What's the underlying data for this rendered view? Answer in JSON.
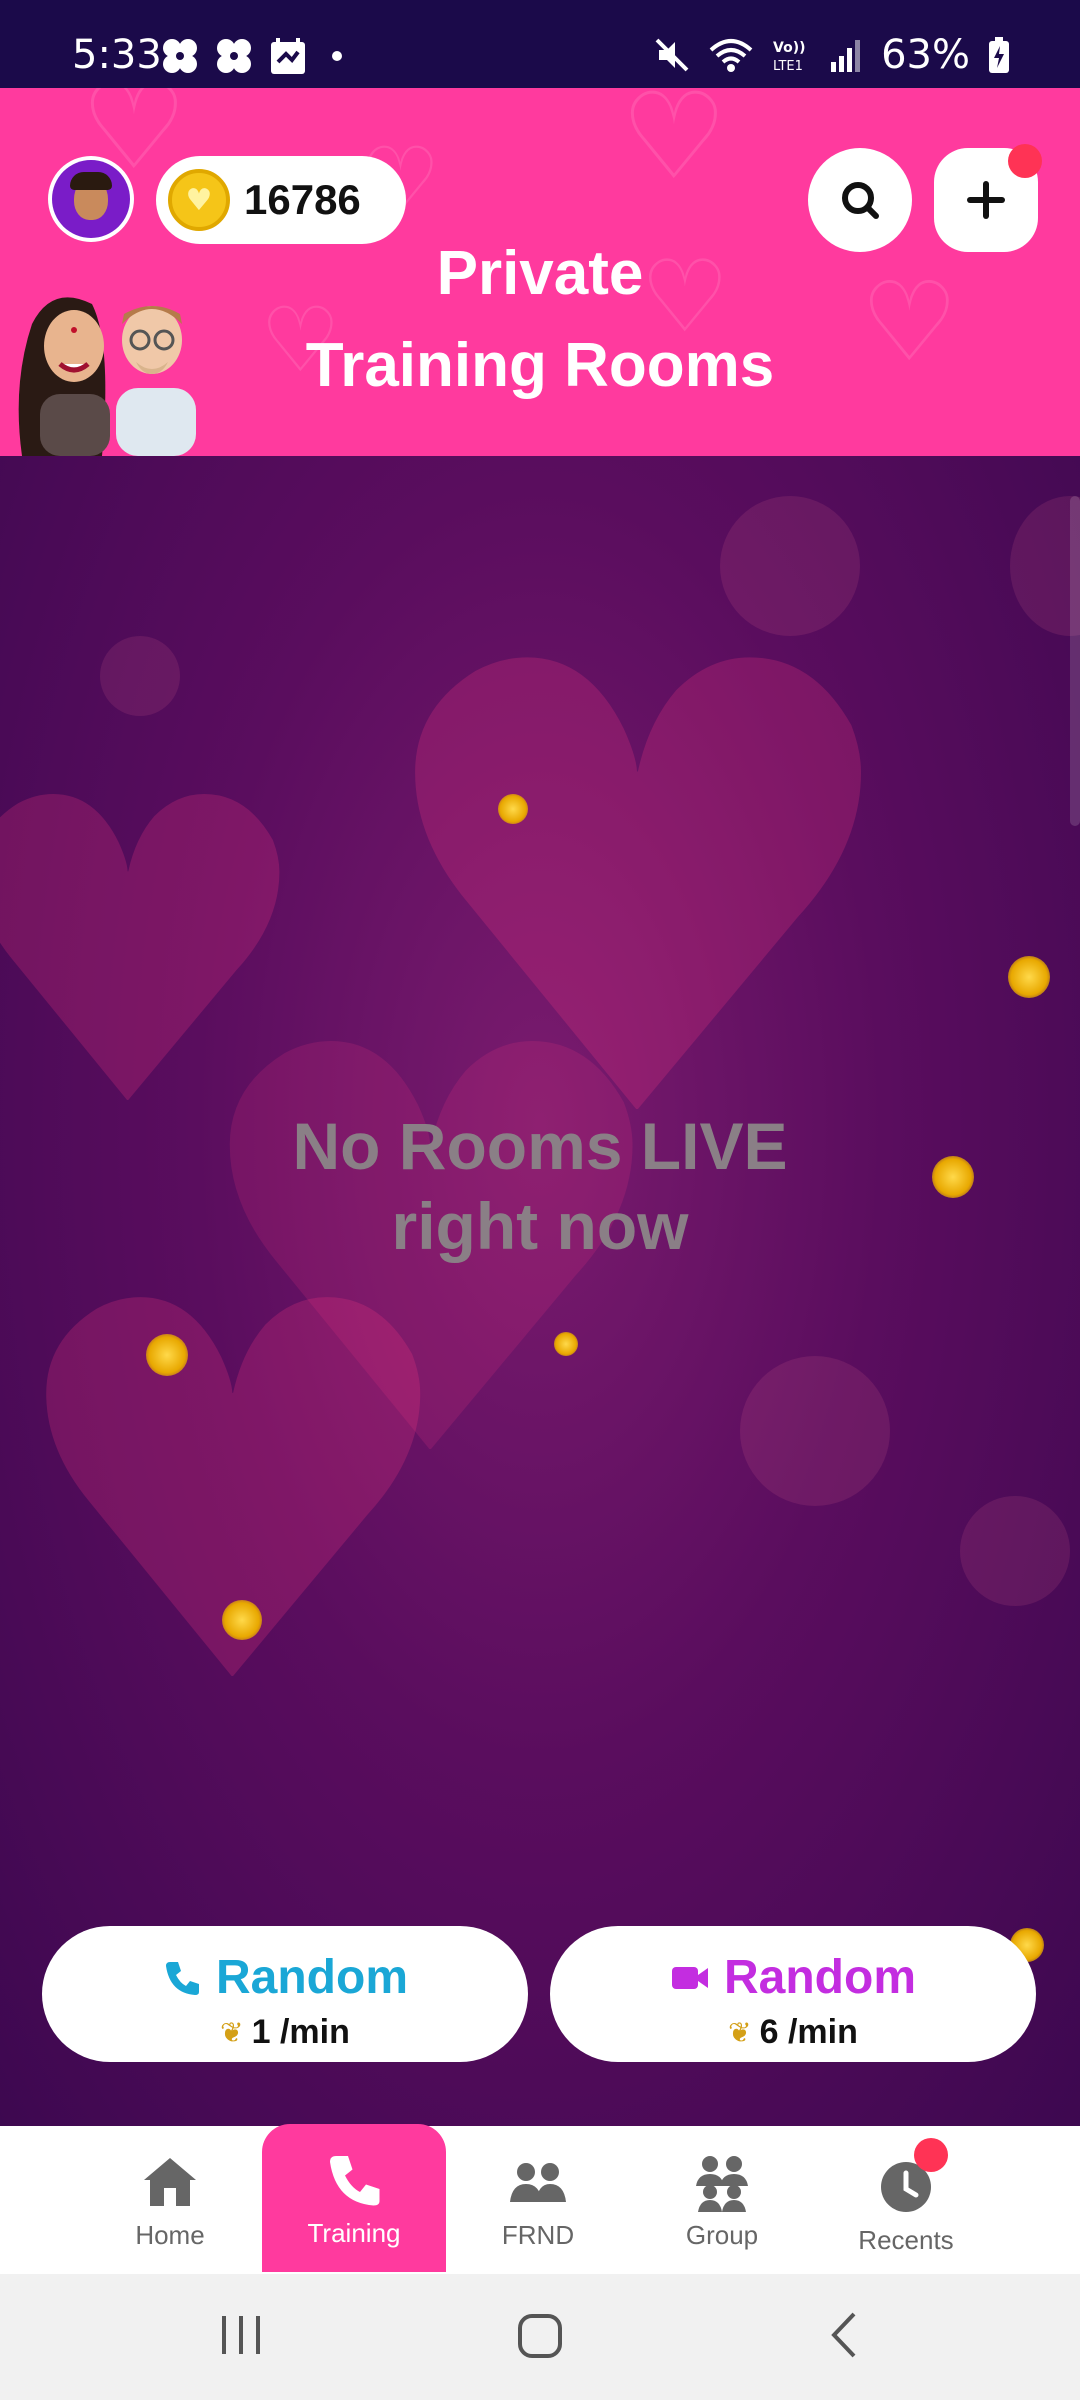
{
  "status_bar": {
    "time": "5:33",
    "battery": "63%",
    "icons": [
      "pinwheel-icon",
      "pinwheel-icon",
      "calendar-icon",
      "mute-icon",
      "wifi-icon",
      "volte-icon",
      "signal-icon",
      "battery-icon"
    ],
    "volte_label": "Vo))\nLTE1"
  },
  "header": {
    "coins": "16786",
    "title_line1": "Private",
    "title_line2": "Training Rooms",
    "background_color": "#ff3a9e"
  },
  "main": {
    "empty_line1": "No Rooms LIVE",
    "empty_line2": "right now"
  },
  "random_buttons": [
    {
      "icon": "phone-icon",
      "label": "Random",
      "rate": "1 /min",
      "color": "#1aa7d6"
    },
    {
      "icon": "video-icon",
      "label": "Random",
      "rate": "6 /min",
      "color": "#c32de0"
    }
  ],
  "bottom_nav": {
    "items": [
      {
        "label": "Home",
        "icon": "home-icon",
        "active": false
      },
      {
        "label": "Training",
        "icon": "phone-icon",
        "active": true
      },
      {
        "label": "FRND",
        "icon": "friends-icon",
        "active": false
      },
      {
        "label": "Group",
        "icon": "group-icon",
        "active": false
      },
      {
        "label": "Recents",
        "icon": "clock-icon",
        "active": false
      }
    ]
  }
}
